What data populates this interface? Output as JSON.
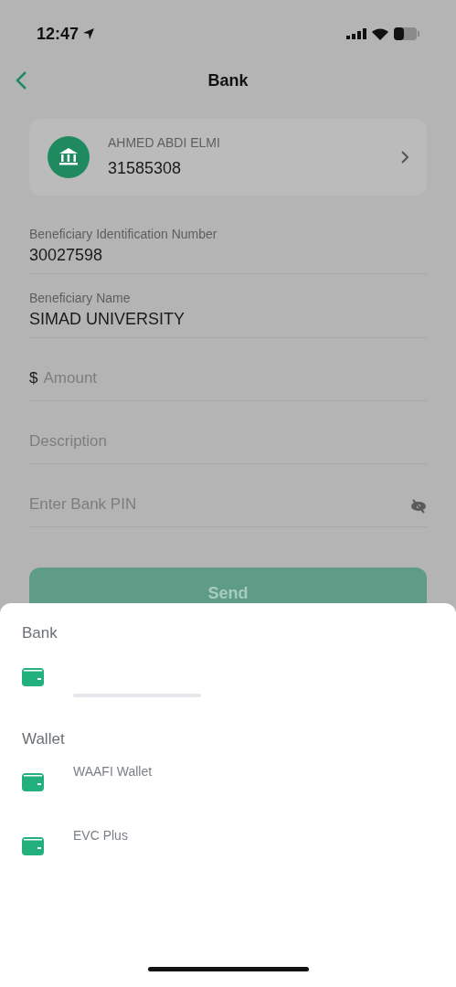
{
  "status_bar": {
    "time": "12:47"
  },
  "nav": {
    "title": "Bank"
  },
  "account_card": {
    "name": "AHMED ABDI ELMI",
    "number": "31585308"
  },
  "fields": [
    {
      "kind": "filled",
      "label": "Beneficiary Identification Number",
      "value": "30027598"
    },
    {
      "kind": "filled",
      "label": "Beneficiary Name",
      "value": "SIMAD UNIVERSITY"
    },
    {
      "kind": "amount",
      "prefix": "$",
      "placeholder": "Amount"
    },
    {
      "kind": "text",
      "placeholder": "Description"
    },
    {
      "kind": "pin",
      "placeholder": "Enter Bank PIN"
    }
  ],
  "send_button": {
    "label": "Send",
    "disabled": true
  },
  "sheet": {
    "sections": [
      {
        "title": "Bank",
        "items": [
          {
            "kind": "hidden"
          }
        ]
      },
      {
        "title": "Wallet",
        "items": [
          {
            "name": "WAAFI Wallet"
          },
          {
            "name": "EVC Plus"
          }
        ]
      }
    ]
  }
}
